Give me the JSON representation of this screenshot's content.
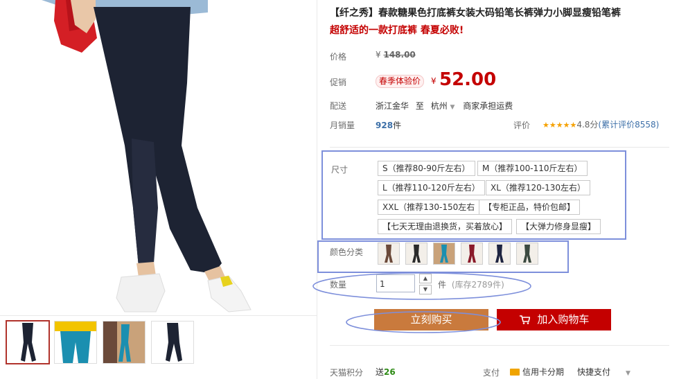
{
  "product": {
    "title": "【纤之秀】春款糖果色打底裤女装大码铅笔长裤弹力小脚显瘦铅笔裤",
    "subtitle": "超舒适的一款打底裤 春夏必败!"
  },
  "price": {
    "label": "价格",
    "currency": "¥",
    "original": "148.00"
  },
  "promo": {
    "label": "促销",
    "badge": "春季体验价",
    "currency": "¥",
    "price": "52.00"
  },
  "delivery": {
    "label": "配送",
    "from": "浙江金华",
    "to_word": "至",
    "to": "杭州",
    "note": "商家承担运费"
  },
  "sales": {
    "label": "月销量",
    "count": "928",
    "unit": "件"
  },
  "rating": {
    "label": "评价",
    "stars": "★★★★★",
    "score": "4.8分",
    "open": "(",
    "link": "累计评价8558",
    "close": ")"
  },
  "size": {
    "label": "尺寸",
    "options": [
      "S（推荐80-90斤左右）",
      "M（推荐100-110斤左右）",
      "L（推荐110-120斤左右）",
      "XL（推荐120-130左右）",
      "XXL（推荐130-150左右",
      "【专柜正品，特价包邮】",
      "【七天无理由退换货，买着放心】",
      "【大弹力修身显瘦】"
    ]
  },
  "color": {
    "label": "颜色分类",
    "swatches": [
      "#6b4a3a",
      "#2a2a2a",
      "#1b8fb0",
      "#8a1a2a",
      "#1e2440",
      "#3c4a40"
    ]
  },
  "quantity": {
    "label": "数量",
    "value": "1",
    "unit": "件",
    "stock": "(库存2789件)"
  },
  "actions": {
    "buy": "立刻购买",
    "cart": "加入购物车"
  },
  "footer": {
    "points_label": "天猫积分",
    "points_prefix": "送",
    "points_value": "26",
    "pay_label": "支付",
    "credit": "信用卡分期",
    "quick": "快捷支付"
  },
  "colors": {
    "accent_red": "#c40000",
    "annotation_blue": "#7d8fdb",
    "buy_orange": "#c97a3d"
  }
}
